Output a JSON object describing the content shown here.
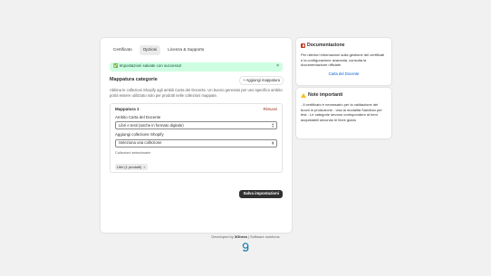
{
  "tabs": [
    {
      "label": "Certificato"
    },
    {
      "label": "Opzioni"
    },
    {
      "label": "Licenza & Supporto"
    }
  ],
  "banner": {
    "message": "✅ Impostazioni salvate con successo!",
    "close": "×"
  },
  "section": {
    "title": "Mappatura categorie",
    "add_button": "+ Aggiungi mappatura",
    "description": "Abbina le collezioni Shopify agli ambiti Carta del Docente. Un buono generato per uno specifico ambito potrà essere utilizzato solo per prodotti nelle collezioni mappate."
  },
  "mapping": {
    "title": "Mappatura 1",
    "remove": "Rimuovi",
    "ambito_label": "Ambito Carta del Docente",
    "ambito_value": "Libri e testi (anche in formato digitale)",
    "collezione_label": "Aggiungi collezione Shopify",
    "collezione_value": "Seleziona una collezione",
    "selected_label": "Collezioni selezionate:",
    "chip": "Libri (1 prodotti)",
    "chip_remove": "×"
  },
  "save_button": "Salva impostazioni",
  "docs": {
    "title": "Documentazione",
    "icon": "book-icon",
    "text": "Per ulteriori informazioni sulla gestione dei certificati e la configurazione avanzata, consulta la documentazione ufficiale.",
    "link": "Carta del Docente"
  },
  "notes": {
    "title": "Note importanti",
    "icon": "warning-icon",
    "text": "- Il certificato è necessario per la validazione dei buoni in produzione - Usa la modalità Sandbox per test - Le categorie devono corrispondere ai beni acquistabili secondo le linee guida"
  },
  "footer": {
    "prefix": "Developed by",
    "brand": "3Ghera",
    "suffix": "| Software solutions"
  },
  "colors": {
    "banner_bg": "#cdfee1",
    "primary": "#303030",
    "link": "#005bd3",
    "danger": "#8e1f0b"
  }
}
